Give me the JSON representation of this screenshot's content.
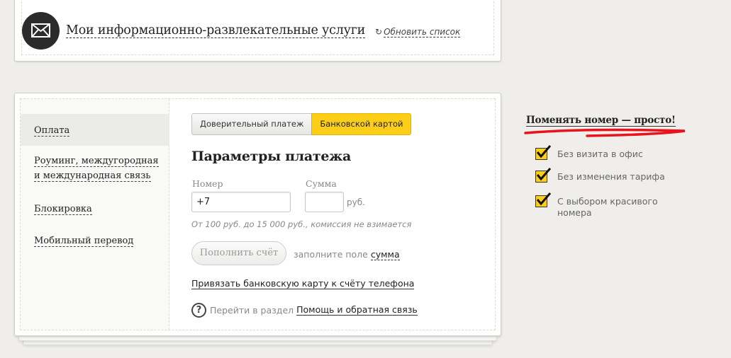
{
  "top_card": {
    "title": "Мои информационно-развлекательные услуги",
    "refresh_label": "Обновить список",
    "refresh_icon": "↻"
  },
  "side_nav": {
    "items": [
      {
        "label": "Оплата"
      },
      {
        "line1": "Роуминг, междугородная",
        "line2": "и международная связь"
      },
      {
        "label": "Блокировка"
      },
      {
        "label": "Мобильный перевод"
      }
    ]
  },
  "tabs": {
    "trust_label": "Доверительный платеж",
    "card_label": "Банковской картой"
  },
  "form": {
    "title": "Параметры платежа",
    "number_label": "Номер",
    "sum_label": "Сумма",
    "phone_value": "+7",
    "currency": "руб.",
    "hint": "От 100 руб. до 15 000 руб., комиссия не взимается",
    "pay_button": "Пополнить счёт",
    "fill_prefix": "заполните поле",
    "fill_link": "сумма",
    "bind_link": "Привязать банковскую карту к счёту телефона",
    "help_prefix": "Перейти в раздел",
    "help_link": "Помощь и обратная связь",
    "help_icon": "?"
  },
  "promo": {
    "title": "Поменять номер — просто!",
    "items": [
      {
        "label": "Без визита в офис"
      },
      {
        "label": "Без изменения тарифа"
      },
      {
        "label": "С выбором красивого номера"
      }
    ]
  },
  "colors": {
    "accent": "#fdce18",
    "background": "#efeeea",
    "underline_red": "#e8131d"
  }
}
